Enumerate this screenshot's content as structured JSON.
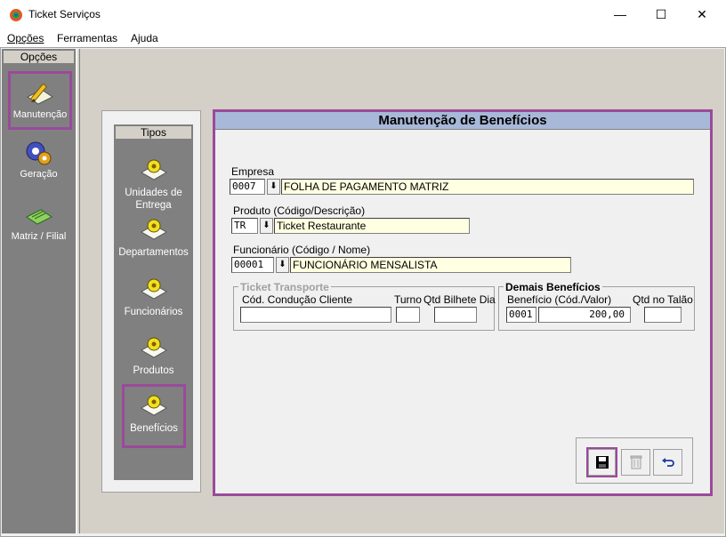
{
  "window": {
    "title": "Ticket Serviços",
    "minimize": "—",
    "maximize": "☐",
    "close": "✕"
  },
  "menu": {
    "opcoes": "Opções",
    "ferramentas": "Ferramentas",
    "ajuda": "Ajuda"
  },
  "sidebar": {
    "header": "Opções",
    "items": [
      {
        "label": "Manutenção",
        "icon": "pencil-document-icon"
      },
      {
        "label": "Geração",
        "icon": "gears-icon"
      },
      {
        "label": "Matriz / Filial",
        "icon": "green-document-icon"
      }
    ]
  },
  "tipos": {
    "header": "Tipos",
    "items": [
      {
        "label": "Unidades de Entrega",
        "icon": "gear-document-icon"
      },
      {
        "label": "Departamentos",
        "icon": "gear-document-icon"
      },
      {
        "label": "Funcionários",
        "icon": "gear-document-icon"
      },
      {
        "label": "Produtos",
        "icon": "gear-document-icon"
      },
      {
        "label": "Benefícios",
        "icon": "gear-document-icon"
      }
    ]
  },
  "form": {
    "title": "Manutenção de Benefícios",
    "empresa": {
      "label": "Empresa",
      "code": "0007",
      "name": "FOLHA DE PAGAMENTO MATRIZ"
    },
    "produto": {
      "label": "Produto (Código/Descrição)",
      "code": "TR",
      "name": "Ticket Restaurante"
    },
    "funcionario": {
      "label": "Funcionário (Código / Nome)",
      "code": "00001",
      "name": "FUNCIONÁRIO MENSALISTA"
    },
    "ticket_transporte": {
      "title": "Ticket Transporte",
      "cod_label": "Cód. Condução Cliente",
      "turno_label": "Turno",
      "qtd_label": "Qtd Bilhete Dia",
      "cod_value": "",
      "turno_value": "",
      "qtd_value": ""
    },
    "demais": {
      "title": "Demais Benefícios",
      "beneficio_label": "Benefício (Cód./Valor)",
      "talao_label": "Qtd no Talão",
      "code": "0001",
      "valor": "200,00",
      "talao_value": ""
    }
  },
  "buttons": {
    "save": "save-icon",
    "delete": "trash-icon",
    "undo": "undo-icon"
  },
  "colors": {
    "highlight": "#9a4a9a",
    "title_band": "#a8b8d8",
    "field_yellow": "#ffffe1"
  }
}
